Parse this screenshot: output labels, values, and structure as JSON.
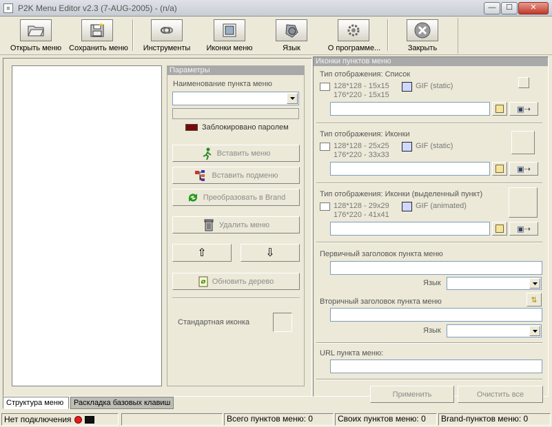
{
  "window": {
    "title": "P2K Menu Editor v2.3 (7-AUG-2005) - (n/a)",
    "minimize": "—",
    "maximize": "☐",
    "close": "✕"
  },
  "toolbar": [
    {
      "label": "Открыть меню",
      "icon": "folder-open-icon"
    },
    {
      "label": "Сохранить меню",
      "icon": "save-icon"
    },
    {
      "label": "Инструменты",
      "icon": "tools-icon"
    },
    {
      "label": "Иконки меню",
      "icon": "image-icon"
    },
    {
      "label": "Язык",
      "icon": "globe-icon"
    },
    {
      "label": "О программе...",
      "icon": "gear-icon"
    },
    {
      "label": "Закрыть",
      "icon": "close-circle-icon"
    }
  ],
  "params": {
    "header": "Параметры",
    "item_name_label": "Наименование пункта меню",
    "item_name_value": "",
    "password_locked": "Заблокировано паролем",
    "insert_menu": "Вставить меню",
    "insert_submenu": "Вставить подменю",
    "convert_brand": "Преобразовать в Brand",
    "delete_menu": "Удалить меню",
    "move_up": "⇧",
    "move_down": "⇩",
    "refresh_tree": "Обновить дерево",
    "standard_icon": "Стандартная иконка"
  },
  "icons_panel": {
    "header": "Иконки пунктов меню",
    "groups": [
      {
        "title": "Тип отображения: Список",
        "size1": "128*128 - 15x15",
        "size2": "176*220 - 15x15",
        "format": "GIF (static)",
        "value": ""
      },
      {
        "title": "Тип отображения: Иконки",
        "size1": "128*128 - 25x25",
        "size2": "176*220 - 33x33",
        "format": "GIF (static)",
        "value": ""
      },
      {
        "title": "Тип отображения: Иконки (выделенный пункт)",
        "size1": "128*128 - 29x29",
        "size2": "176*220 - 41x41",
        "format": "GIF (animated)",
        "value": ""
      }
    ],
    "primary_title_label": "Первичный заголовок пункта меню",
    "primary_title_value": "",
    "language_label": "Язык",
    "primary_language": "",
    "secondary_title_label": "Вторичный заголовок пункта меню",
    "secondary_title_value": "",
    "secondary_language": "",
    "url_label": "URL пункта меню:",
    "url_value": "",
    "apply": "Применить",
    "clear_all": "Очистить все"
  },
  "tabs": [
    {
      "label": "Структура меню",
      "active": true
    },
    {
      "label": "Раскладка базовых клавиш",
      "active": false
    }
  ],
  "status": {
    "connection": "Нет подключения",
    "connection_color": "#e81c1c",
    "total_items": "Всего пунктов меню: 0",
    "own_items": "Своих пунктов меню: 0",
    "brand_items": "Brand-пунктов меню: 0"
  }
}
